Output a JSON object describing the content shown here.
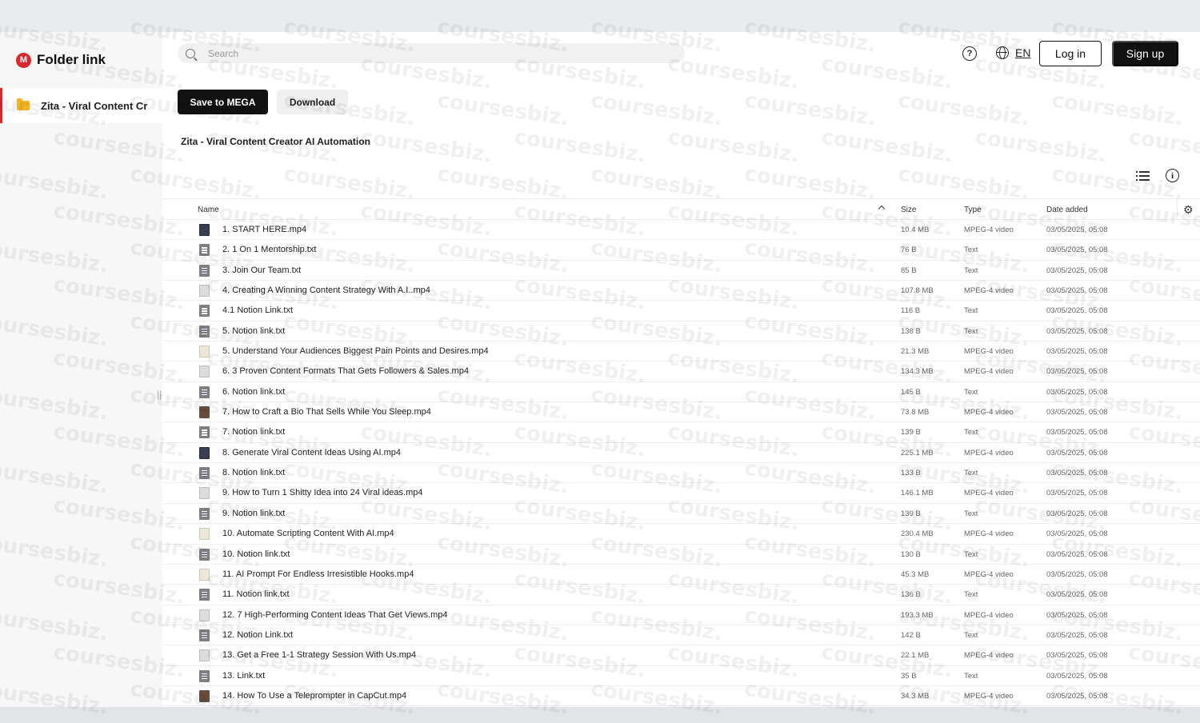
{
  "app": {
    "logo_letter": "M",
    "title": "Folder link",
    "brand_color": "#d9272e"
  },
  "sidebar": {
    "folder_label": "Zita - Viral Content Cr",
    "resize_handle": "||"
  },
  "search": {
    "placeholder": "Search"
  },
  "header": {
    "help_glyph": "?",
    "lang": "EN",
    "login": "Log in",
    "signup": "Sign up"
  },
  "actions": {
    "save": "Save to MEGA",
    "download": "Download"
  },
  "breadcrumb": "Zita - Viral Content Creator AI Automation",
  "view": {
    "info_glyph": "i",
    "settings_glyph": "⚙"
  },
  "columns": {
    "name": "Name",
    "size": "Size",
    "type": "Type",
    "date": "Date added"
  },
  "files": [
    {
      "name": "1. START HERE.mp4",
      "size": "10.4 MB",
      "type": "MPEG-4 video",
      "date": "03/05/2025, 05:08",
      "icon": "video-dark"
    },
    {
      "name": "2. 1 On 1 Mentorship.txt",
      "size": "76 B",
      "type": "Text",
      "date": "03/05/2025, 05:08",
      "icon": "text"
    },
    {
      "name": "3. Join Our Team.txt",
      "size": "85 B",
      "type": "Text",
      "date": "03/05/2025, 05:08",
      "icon": "text"
    },
    {
      "name": "4. Creating A Winning Content Strategy With A.I..mp4",
      "size": "107.8 MB",
      "type": "MPEG-4 video",
      "date": "03/05/2025, 05:08",
      "icon": "video"
    },
    {
      "name": "4.1 Notion Link.txt",
      "size": "116 B",
      "type": "Text",
      "date": "03/05/2025, 05:08",
      "icon": "text"
    },
    {
      "name": "5. Notion link.txt",
      "size": "138 B",
      "type": "Text",
      "date": "03/05/2025, 05:08",
      "icon": "text"
    },
    {
      "name": "5. Understand Your Audiences Biggest Pain Points and Desires.mp4",
      "size": "21.3 MB",
      "type": "MPEG-4 video",
      "date": "03/05/2025, 05:08",
      "icon": "video-beige"
    },
    {
      "name": "6. 3 Proven Content Formats That Gets Followers & Sales.mp4",
      "size": "134.3 MB",
      "type": "MPEG-4 video",
      "date": "03/05/2025, 05:08",
      "icon": "video"
    },
    {
      "name": "6. Notion link.txt",
      "size": "145 B",
      "type": "Text",
      "date": "03/05/2025, 05:08",
      "icon": "text"
    },
    {
      "name": "7. How to Craft a Bio That Sells While You Sleep.mp4",
      "size": "73.8 MB",
      "type": "MPEG-4 video",
      "date": "03/05/2025, 05:08",
      "icon": "video-photo"
    },
    {
      "name": "7. Notion link.txt",
      "size": "139 B",
      "type": "Text",
      "date": "03/05/2025, 05:08",
      "icon": "text"
    },
    {
      "name": "8. Generate Viral Content Ideas Using AI.mp4",
      "size": "225.1 MB",
      "type": "MPEG-4 video",
      "date": "03/05/2025, 05:08",
      "icon": "video-dark"
    },
    {
      "name": "8. Notion link.txt",
      "size": "133 B",
      "type": "Text",
      "date": "03/05/2025, 05:08",
      "icon": "text"
    },
    {
      "name": "9. How to Turn 1 Shitty Idea into 24 Viral ideas.mp4",
      "size": "146.1 MB",
      "type": "MPEG-4 video",
      "date": "03/05/2025, 05:08",
      "icon": "video"
    },
    {
      "name": "9. Notion link.txt",
      "size": "139 B",
      "type": "Text",
      "date": "03/05/2025, 05:08",
      "icon": "text"
    },
    {
      "name": "10. Automate Scripting Content With AI.mp4",
      "size": "230.4 MB",
      "type": "MPEG-4 video",
      "date": "03/05/2025, 05:08",
      "icon": "video-beige"
    },
    {
      "name": "10. Notion link.txt",
      "size": "130 B",
      "type": "Text",
      "date": "03/05/2025, 05:08",
      "icon": "text"
    },
    {
      "name": "11. AI Prompt For Endless Irresistible Hooks.mp4",
      "size": "45.3 MB",
      "type": "MPEG-4 video",
      "date": "03/05/2025, 05:08",
      "icon": "video-beige"
    },
    {
      "name": "11. Notion link.txt",
      "size": "136 B",
      "type": "Text",
      "date": "03/05/2025, 05:08",
      "icon": "text"
    },
    {
      "name": "12. 7 High-Performing Content Ideas That Get Views.mp4",
      "size": "193.3 MB",
      "type": "MPEG-4 video",
      "date": "03/05/2025, 05:08",
      "icon": "video"
    },
    {
      "name": "12. Notion Link.txt",
      "size": "142 B",
      "type": "Text",
      "date": "03/05/2025, 05:08",
      "icon": "text"
    },
    {
      "name": "13. Get a Free 1-1 Strategy Session With Us.mp4",
      "size": "22.1 MB",
      "type": "MPEG-4 video",
      "date": "03/05/2025, 05:08",
      "icon": "video"
    },
    {
      "name": "13. Link.txt",
      "size": "35 B",
      "type": "Text",
      "date": "03/05/2025, 05:08",
      "icon": "text"
    },
    {
      "name": "14. How To Use a Teleprompter in CapCut.mp4",
      "size": "34.3 MB",
      "type": "MPEG-4 video",
      "date": "03/05/2025, 05:08",
      "icon": "video-photo"
    }
  ],
  "watermark_text": "coursesbiz."
}
